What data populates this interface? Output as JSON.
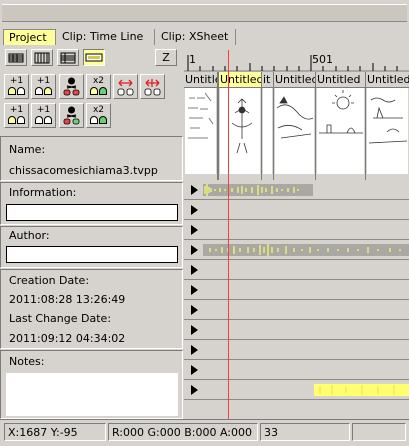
{
  "tabs": [
    {
      "label": "Project",
      "active": true
    },
    {
      "label": "Clip: Time Line",
      "active": false
    },
    {
      "label": "Clip: XSheet",
      "active": false
    }
  ],
  "toolbar": {
    "view_icons": [
      "thumbnail-view-icon",
      "column-view-icon",
      "list-view-icon",
      "timeline-view-icon"
    ],
    "z_label": "Z"
  },
  "actions": {
    "row1": [
      "+1",
      "+1",
      "skull",
      "x2",
      "swap",
      "swap"
    ],
    "row2": [
      "+1",
      "+1",
      "skull",
      "x2"
    ]
  },
  "project": {
    "name_label": "Name:",
    "name_value": "chissacomesichiama3.tvpp",
    "information_label": "Information:",
    "information_value": "",
    "author_label": "Author:",
    "author_value": "",
    "creation_label": "Creation Date:",
    "creation_value": "2011:08:28 13:26:49",
    "change_label": "Last Change Date:",
    "change_value": "2011:09:12 04:34:02",
    "notes_label": "Notes:",
    "notes_value": ""
  },
  "ruler": {
    "marks": [
      "1",
      "501"
    ]
  },
  "clips": [
    {
      "title": "Untitle",
      "selected": false
    },
    {
      "title": "Untitled",
      "selected": true
    },
    {
      "title": "it",
      "selected": false
    },
    {
      "title": "Untitled",
      "selected": false
    },
    {
      "title": "Untitled",
      "selected": false
    },
    {
      "title": "Untitled",
      "selected": false
    }
  ],
  "tracks_count": 11,
  "status": {
    "coords": "X:1687  Y:-95",
    "color": "R:000 G:000 B:000 A:000",
    "value": "33"
  },
  "colors": {
    "active_tab": "#ffff9a",
    "playhead": "#ff3a3a",
    "audio_wave": "#ffff70"
  }
}
